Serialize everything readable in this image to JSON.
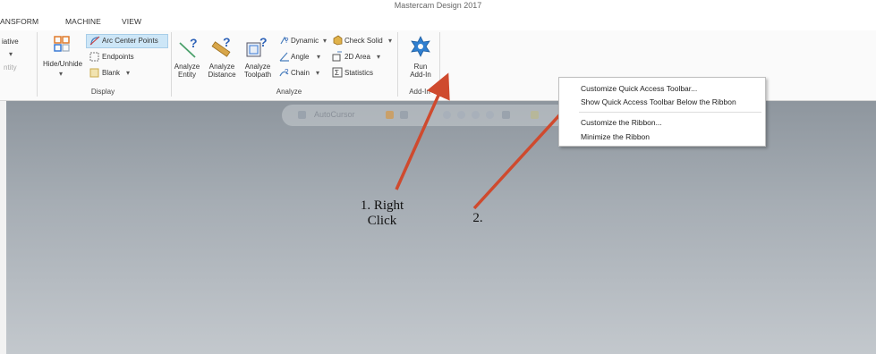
{
  "window": {
    "title": "Mastercam Design 2017"
  },
  "menu": {
    "tabs": [
      "ANSFORM",
      "MACHINE",
      "VIEW"
    ]
  },
  "ribbon": {
    "left_partial": {
      "relative": "iative",
      "entity": "ntity"
    },
    "display": {
      "label": "Display",
      "hide_unhide": "Hide/Unhide",
      "arc_center_points": "Arc Center Points",
      "endpoints": "Endpoints",
      "blank": "Blank"
    },
    "analyze": {
      "label": "Analyze",
      "analyze_entity_l1": "Analyze",
      "analyze_entity_l2": "Entity",
      "analyze_distance_l1": "Analyze",
      "analyze_distance_l2": "Distance",
      "analyze_toolpath_l1": "Analyze",
      "analyze_toolpath_l2": "Toolpath",
      "dynamic": "Dynamic",
      "angle": "Angle",
      "chain": "Chain",
      "check_solid": "Check Solid",
      "area_2d": "2D Area",
      "statistics": "Statistics"
    },
    "addin": {
      "label": "Add-In",
      "run_l1": "Run",
      "run_l2": "Add-In"
    }
  },
  "qat": {
    "autocursor": "AutoCursor"
  },
  "context_menu": {
    "items": [
      "Customize Quick Access Toolbar...",
      "Show Quick Access Toolbar Below the Ribbon",
      "Customize the Ribbon...",
      "Minimize the Ribbon"
    ]
  },
  "annotations": {
    "step1_l1": "1. Right",
    "step1_l2": "Click",
    "step2": "2."
  },
  "colors": {
    "arrow": "#cf4a2e",
    "highlight": "#cde6f7",
    "viewport_top": "#8e969e",
    "viewport_bottom": "#c3c8cd"
  }
}
